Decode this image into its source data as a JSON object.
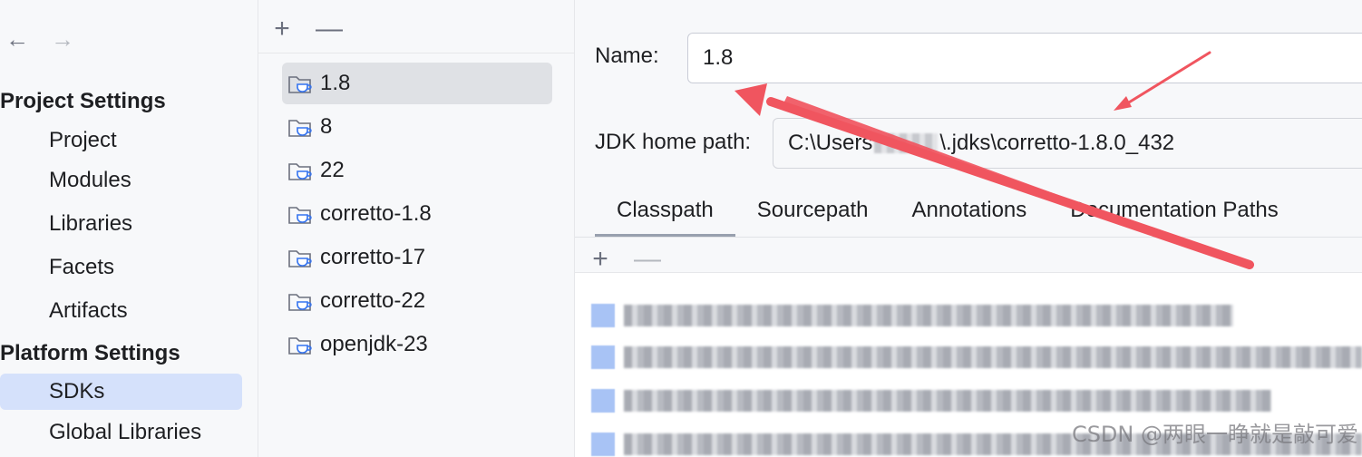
{
  "nav": {
    "back_icon": "arrow-left-icon",
    "forward_icon": "arrow-right-icon"
  },
  "sidebar": {
    "project_settings_title": "Project Settings",
    "project_items": [
      {
        "label": "Project"
      },
      {
        "label": "Modules"
      },
      {
        "label": "Libraries"
      },
      {
        "label": "Facets"
      },
      {
        "label": "Artifacts"
      }
    ],
    "platform_settings_title": "Platform Settings",
    "platform_items": [
      {
        "label": "SDKs",
        "selected": true
      },
      {
        "label": "Global Libraries"
      }
    ]
  },
  "sdk_panel": {
    "add_icon": "plus-icon",
    "remove_icon": "minus-icon",
    "sdks": [
      {
        "label": "1.8",
        "selected": true
      },
      {
        "label": "8"
      },
      {
        "label": "22"
      },
      {
        "label": "corretto-1.8"
      },
      {
        "label": "corretto-17"
      },
      {
        "label": "corretto-22"
      },
      {
        "label": "openjdk-23"
      }
    ]
  },
  "detail": {
    "name_label": "Name:",
    "name_value": "1.8",
    "jdk_home_label": "JDK home path:",
    "jdk_home_prefix": "C:\\Users",
    "jdk_home_suffix": "\\.jdks\\corretto-1.8.0_432",
    "tabs": [
      {
        "label": "Classpath",
        "active": true
      },
      {
        "label": "Sourcepath"
      },
      {
        "label": "Annotations"
      },
      {
        "label": "Documentation Paths"
      }
    ],
    "classpath_entries_count": 4
  },
  "watermark": "CSDN @两眼一睁就是敲可爱",
  "colors": {
    "selection": "#d5e1fb",
    "annotation_arrow": "#f0555f",
    "jar_icon": "#a8c3f5"
  }
}
